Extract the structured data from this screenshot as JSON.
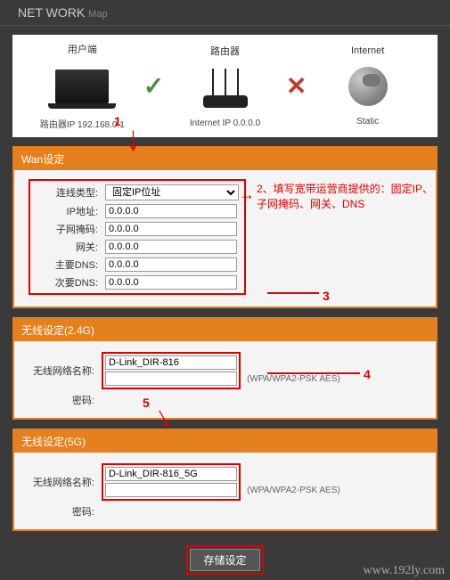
{
  "header": {
    "title": "NET WORK",
    "sub": "Map"
  },
  "map": {
    "client": {
      "top": "用户端",
      "bot": "路由器IP 192.168.0.1"
    },
    "router": {
      "top": "路由器",
      "bot": "Internet IP 0.0.0.0"
    },
    "internet": {
      "top": "Internet",
      "bot": "Static"
    }
  },
  "wan": {
    "title": "Wan设定",
    "rows": {
      "type_label": "连线类型:",
      "type_value": "固定IP位址",
      "ip_label": "IP地址:",
      "ip_value": "0.0.0.0",
      "mask_label": "子网掩码:",
      "mask_value": "0.0.0.0",
      "gw_label": "网关:",
      "gw_value": "0.0.0.0",
      "dns1_label": "主要DNS:",
      "dns1_value": "0.0.0.0",
      "dns2_label": "次要DNS:",
      "dns2_value": "0.0.0.0"
    }
  },
  "wifi24": {
    "title": "无线设定(2.4G)",
    "ssid_label": "无线网络名称:",
    "ssid_value": "D-Link_DIR-816",
    "pwd_label": "密码:",
    "pwd_value": "",
    "hint": "(WPA/WPA2-PSK AES)"
  },
  "wifi5": {
    "title": "无线设定(5G)",
    "ssid_label": "无线网络名称:",
    "ssid_value": "D-Link_DIR-816_5G",
    "pwd_label": "密码:",
    "pwd_value": "",
    "hint": "(WPA/WPA2-PSK AES)"
  },
  "save": "存储设定",
  "annot": {
    "n1": "1",
    "n2": "2、填写宽带运营商提供的：固定IP、子网掩码、网关、DNS",
    "n3": "3",
    "n4": "4",
    "n5": "5"
  },
  "watermark": "www.192ly.com"
}
